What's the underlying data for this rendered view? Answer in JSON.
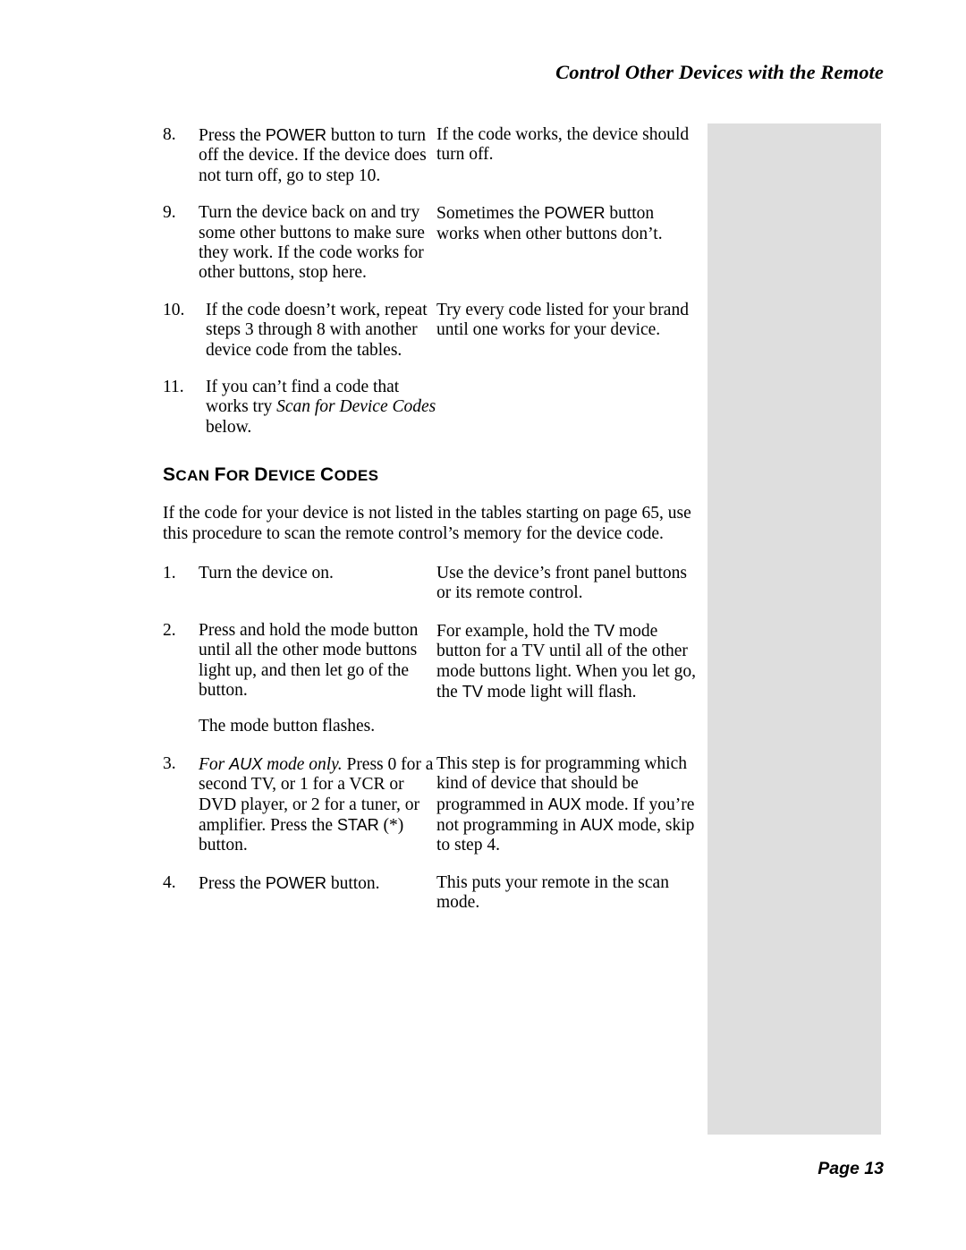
{
  "header": {
    "running_title": "Control Other Devices with the Remote"
  },
  "footer": {
    "page_label": "Page 13"
  },
  "sidebar": {
    "color": "#dedede",
    "content": ""
  },
  "main": {
    "continued_steps": [
      {
        "number": "8.",
        "instruction_pre": "Press the ",
        "instruction_key": "POWER",
        "instruction_post": " button to turn off the device. If the device does not turn off, go to step 10.",
        "explanation": "If the code works, the device should turn off."
      },
      {
        "number": "9.",
        "instruction_pre": "Turn the device back on and try some other buttons to make sure they work. If the code works for other buttons, stop here.",
        "instruction_key": "",
        "instruction_post": "",
        "explanation_pre": "Sometimes the ",
        "explanation_key": "POWER",
        "explanation_post": " button works when other buttons don’t."
      },
      {
        "number": "10.",
        "instruction_pre": "If the code doesn’t work, repeat steps 3 through 8 with another device code from the tables.",
        "instruction_key": "",
        "instruction_post": "",
        "explanation": "Try every code listed for your brand until one works for your device."
      },
      {
        "number": "11.",
        "instruction_pre": "If you can’t find a code that works try ",
        "instruction_italic": "Scan for Device Codes",
        "instruction_post": " below.",
        "explanation": ""
      }
    ],
    "section": {
      "heading_words": [
        {
          "cap": "S",
          "rest": "CAN"
        },
        {
          "cap": "F",
          "rest": "OR"
        },
        {
          "cap": "D",
          "rest": "EVICE"
        },
        {
          "cap": "C",
          "rest": "ODES"
        }
      ],
      "heading_plain": "SCAN FOR DEVICE CODES",
      "intro": "If the code for your device is not listed in the tables starting on page 65, use this procedure to scan the remote control’s memory for the device code.",
      "steps": [
        {
          "number": "1.",
          "instruction": "Turn the device on.",
          "explanation": "Use the device’s front panel buttons or its remote control."
        },
        {
          "number": "2.",
          "instruction": "Press and hold the mode button until all the other mode buttons light up, and then let go of the button.",
          "instruction_extra": "The mode button flashes.",
          "explanation_a": "For example, hold the ",
          "explanation_key1": "TV",
          "explanation_b": " mode button for a TV until all of the other mode buttons light. When you let go, the ",
          "explanation_key2": "TV",
          "explanation_c": " mode light will flash."
        },
        {
          "number": "3.",
          "instruction_italic_a": "For ",
          "instruction_italic_key": "AUX",
          "instruction_italic_b": " mode only.",
          "instruction_a": " Press 0 for a second TV, or 1 for a VCR or DVD player, or 2 for a tuner, or amplifier. Press the ",
          "instruction_key": "STAR",
          "instruction_b": " (*) button.",
          "explanation_a": "This step is for programming which kind of device that should be programmed in ",
          "explanation_key1": "AUX",
          "explanation_b": " mode. If you’re not programming in ",
          "explanation_key2": "AUX",
          "explanation_c": " mode, skip to step 4."
        },
        {
          "number": "4.",
          "instruction_pre": "Press the ",
          "instruction_key": "POWER",
          "instruction_post": " button.",
          "explanation": "This puts your remote in the scan mode."
        }
      ]
    }
  }
}
